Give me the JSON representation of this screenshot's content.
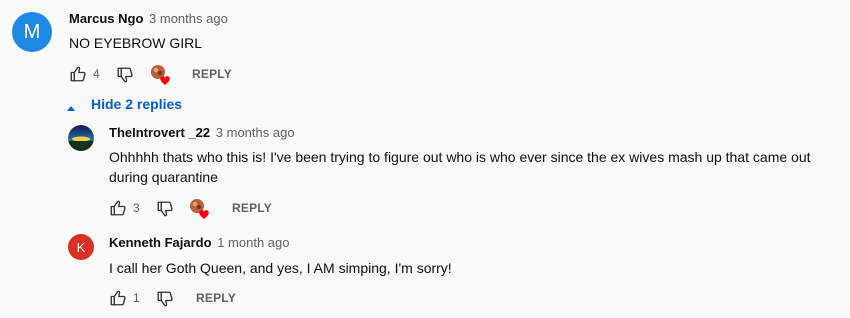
{
  "comments": [
    {
      "author": "Marcus Ngo",
      "time": "3 months ago",
      "avatar_letter": "M",
      "avatar_color": "#1e88e5",
      "text": "NO EYEBROW GIRL",
      "likes": "4",
      "hearted": true,
      "reply_label": "REPLY"
    }
  ],
  "toggle_replies_label": "Hide 2 replies",
  "replies": [
    {
      "author": "TheIntrovert _22",
      "time": "3 months ago",
      "avatar_type": "image",
      "text_line1": "Ohhhhh thats who this is! I've been trying to figure out who is who ever since the ex wives mash up that came out",
      "text_line2": "during quarantine",
      "likes": "3",
      "hearted": true,
      "reply_label": "REPLY"
    },
    {
      "author": "Kenneth Fajardo",
      "time": "1 month ago",
      "avatar_letter": "K",
      "avatar_color": "#d93025",
      "text": "I call her Goth Queen, and yes, I AM simping, I'm sorry!",
      "likes": "1",
      "hearted": false,
      "reply_label": "REPLY"
    }
  ],
  "colors": {
    "link_blue": "#065fd4",
    "heart_red": "#ff0000",
    "muted": "#606060"
  }
}
